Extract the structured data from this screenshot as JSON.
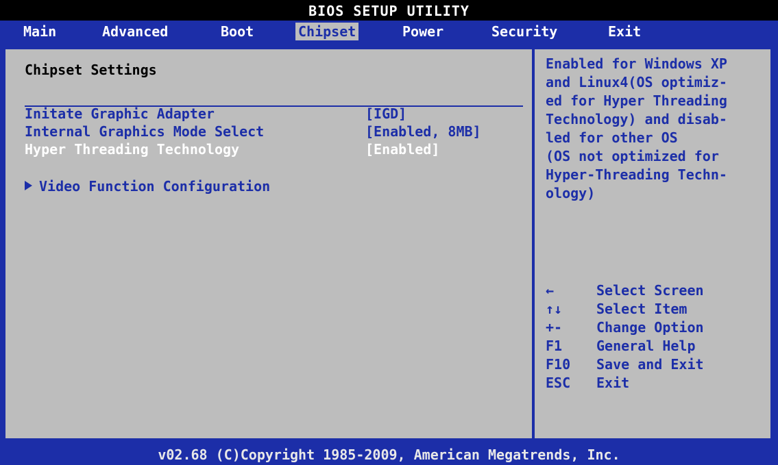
{
  "header": {
    "title": "BIOS SETUP UTILITY"
  },
  "menu": {
    "items": [
      {
        "label": "Main"
      },
      {
        "label": "Advanced"
      },
      {
        "label": "Boot"
      },
      {
        "label": "Chipset"
      },
      {
        "label": "Power"
      },
      {
        "label": "Security"
      },
      {
        "label": "Exit"
      }
    ],
    "active": "Chipset"
  },
  "settings": {
    "heading": "Chipset Settings",
    "rows": [
      {
        "label": "Initate Graphic Adapter",
        "value": "[IGD]"
      },
      {
        "label": "Internal Graphics Mode Select",
        "value": "[Enabled, 8MB]"
      },
      {
        "label": "Hyper Threading Technology",
        "value": "[Enabled]",
        "highlighted": true
      }
    ],
    "submenu": {
      "label": "Video Function Configuration"
    }
  },
  "help": {
    "lines": [
      "Enabled for Windows XP",
      "and Linux4(OS optimiz-",
      "ed for Hyper Threading",
      "Technology) and disab-",
      "led for other OS",
      "(OS not optimized for",
      "Hyper-Threading Techn-",
      "ology)"
    ],
    "keys": [
      {
        "key": "←",
        "desc": "Select Screen"
      },
      {
        "key": "↑↓",
        "desc": "Select Item"
      },
      {
        "key": "+-",
        "desc": "Change Option"
      },
      {
        "key": "F1",
        "desc": "General Help"
      },
      {
        "key": "F10",
        "desc": "Save and Exit"
      },
      {
        "key": "ESC",
        "desc": "Exit"
      }
    ]
  },
  "footer": {
    "text": "v02.68 (C)Copyright 1985-2009, American Megatrends, Inc."
  },
  "colors": {
    "blue": "#1c2ea8",
    "panel_gray": "#bdbdbd",
    "highlight": "#ffffff"
  }
}
